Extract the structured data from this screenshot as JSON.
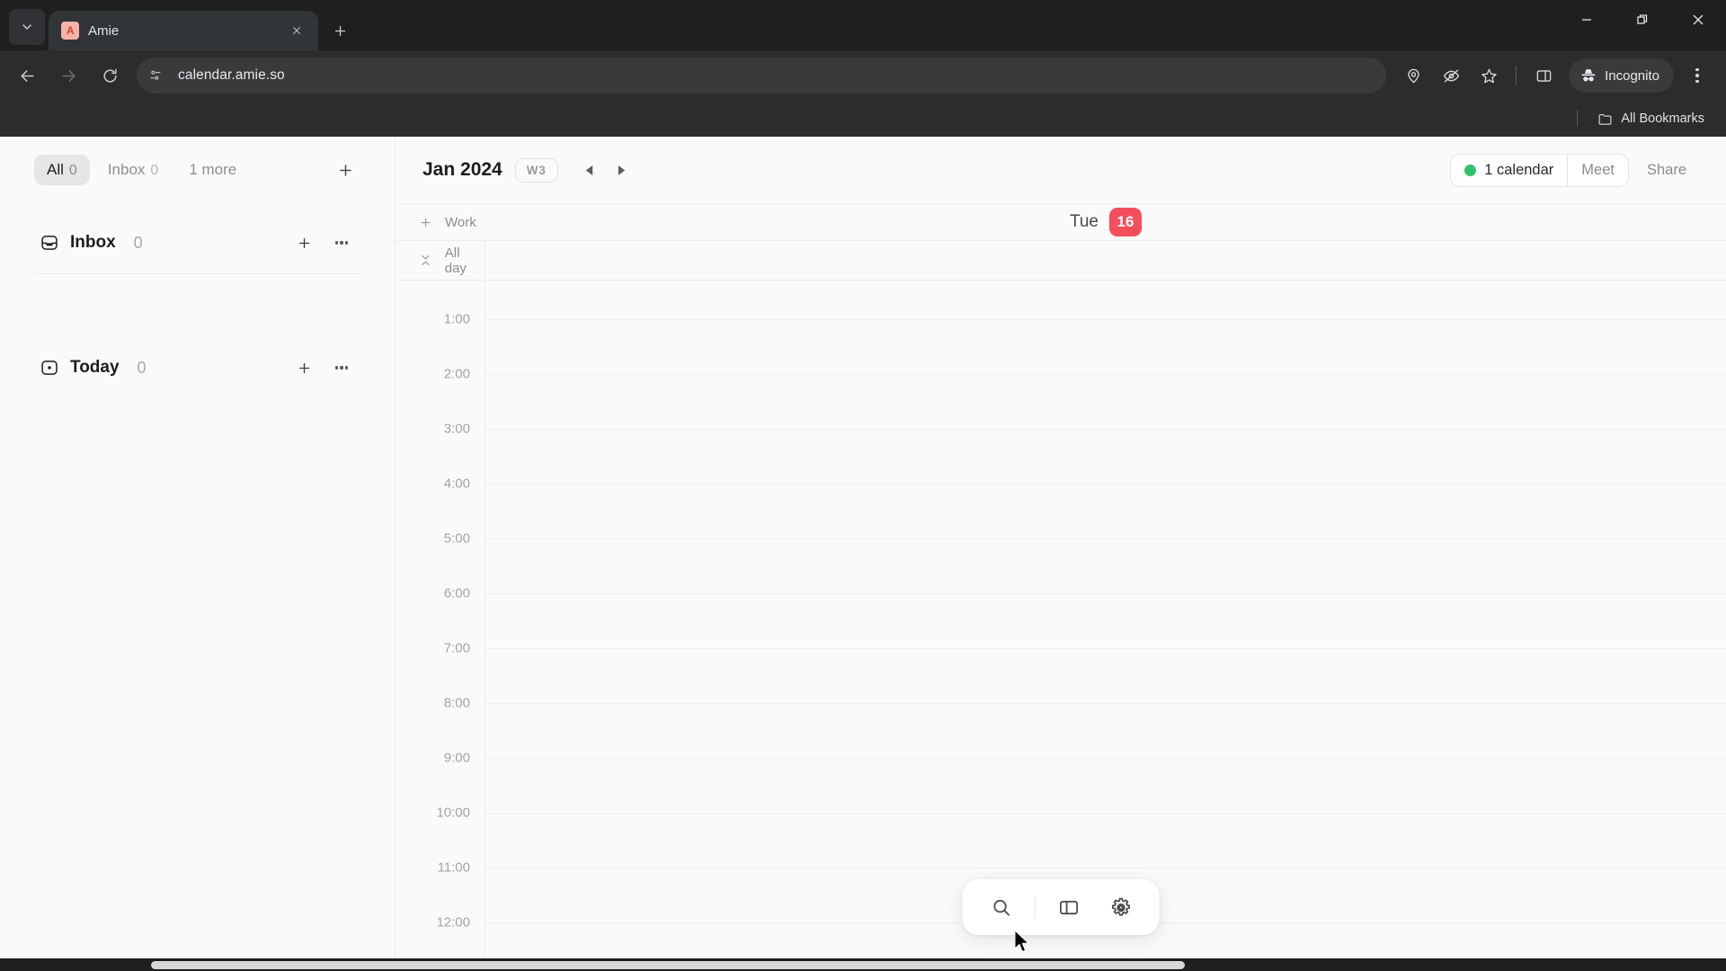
{
  "browser": {
    "tab": {
      "title": "Amie",
      "favicon_letter": "A"
    },
    "url": "calendar.amie.so",
    "profile_label": "Incognito",
    "bookmarks_label": "All Bookmarks",
    "icons": {
      "tab_search": "chevron-down-icon",
      "new_tab": "plus-icon",
      "back": "back-arrow-icon",
      "forward": "forward-arrow-icon",
      "reload": "reload-icon",
      "site_info": "page-settings-icon",
      "location": "location-pin-icon",
      "tracking": "eye-off-icon",
      "bookmark": "star-icon",
      "side_panel": "side-panel-icon",
      "menu": "three-dots-icon",
      "minimize": "minimize-icon",
      "restore": "restore-icon",
      "close": "close-icon"
    }
  },
  "sidebar": {
    "tabs": [
      {
        "label": "All",
        "count": "0",
        "active": true
      },
      {
        "label": "Inbox",
        "count": "0",
        "active": false
      },
      {
        "label": "1 more",
        "count": "",
        "active": false
      }
    ],
    "add_button": "plus-icon",
    "groups": [
      {
        "title": "Inbox",
        "count": "0",
        "icon": "inbox-icon"
      },
      {
        "title": "Today",
        "count": "0",
        "icon": "today-icon"
      }
    ]
  },
  "calendar": {
    "month": "Jan 2024",
    "week_badge": "W3",
    "prev_label": "previous-week",
    "next_label": "next-week",
    "calendar_pill": "1 calendar",
    "calendar_dot_color": "#31c06a",
    "meet_label": "Meet",
    "share_label": "Share",
    "work_label": "Work",
    "allday_label": "All day",
    "day": {
      "weekday": "Tue",
      "date": "16",
      "badge_color": "#f24e5c"
    },
    "times": [
      "1:00",
      "2:00",
      "3:00",
      "4:00",
      "5:00",
      "6:00",
      "7:00",
      "8:00",
      "9:00",
      "10:00",
      "11:00",
      "12:00"
    ]
  },
  "float_toolbar": {
    "search": "search-icon",
    "panel": "panel-toggle-icon",
    "settings": "gear-icon"
  }
}
